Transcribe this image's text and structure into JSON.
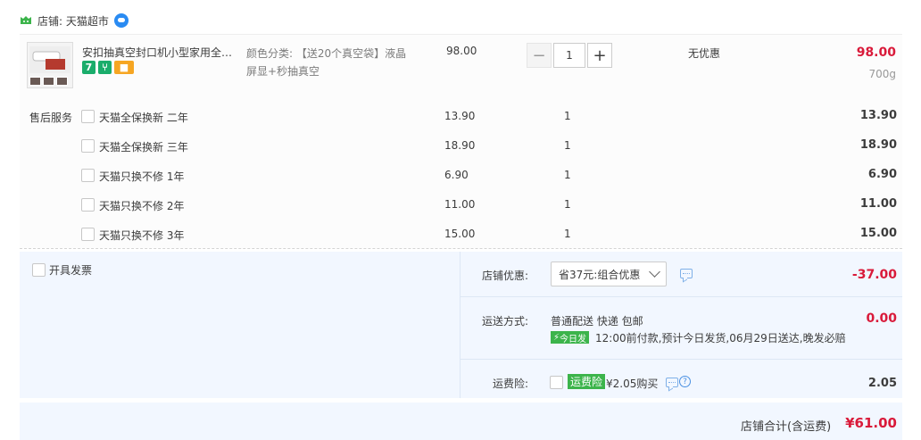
{
  "shop": {
    "label": "店铺: 天猫超市",
    "icon": "tmall-icon",
    "chat_icon": "wangwang-chat-icon"
  },
  "item": {
    "title": "安扣抽真空封口机小型家用全自动...",
    "badges": [
      "7",
      "⑂",
      "■"
    ],
    "sku": "颜色分类: 【送20个真空袋】液晶屏显+秒抽真空",
    "unit_price": "98.00",
    "quantity": "1",
    "promo": "无优惠",
    "total": "98.00",
    "weight": "700g"
  },
  "services": {
    "heading": "售后服务",
    "rows": [
      {
        "name": "天猫全保换新 二年",
        "price": "13.90",
        "qty": "1",
        "total": "13.90"
      },
      {
        "name": "天猫全保换新 三年",
        "price": "18.90",
        "qty": "1",
        "total": "18.90"
      },
      {
        "name": "天猫只换不修 1年",
        "price": "6.90",
        "qty": "1",
        "total": "6.90"
      },
      {
        "name": "天猫只换不修 2年",
        "price": "11.00",
        "qty": "1",
        "total": "11.00"
      },
      {
        "name": "天猫只换不修 3年",
        "price": "15.00",
        "qty": "1",
        "total": "15.00"
      }
    ]
  },
  "invoice": {
    "label": "开具发票"
  },
  "discount": {
    "label": "店铺优惠:",
    "selected": "省37元:组合优惠",
    "amount": "-37.00"
  },
  "shipping": {
    "label": "运送方式:",
    "method": "普通配送 快递 包邮",
    "badge": "今日发",
    "note": "12:00前付款,预计今日发货,06月29日送达,晚发必赔",
    "amount": "0.00"
  },
  "insurance": {
    "label": "运费险:",
    "tag": "运费险",
    "price": "¥2.05购买",
    "amount": "2.05"
  },
  "summary": {
    "label": "店铺合计(含运费)",
    "total": "¥61.00"
  },
  "colors": {
    "price_red": "#d91a3a",
    "accent_blue": "#2a8bf2",
    "green": "#3cb44b",
    "panel_bg": "#f2f7ff"
  }
}
